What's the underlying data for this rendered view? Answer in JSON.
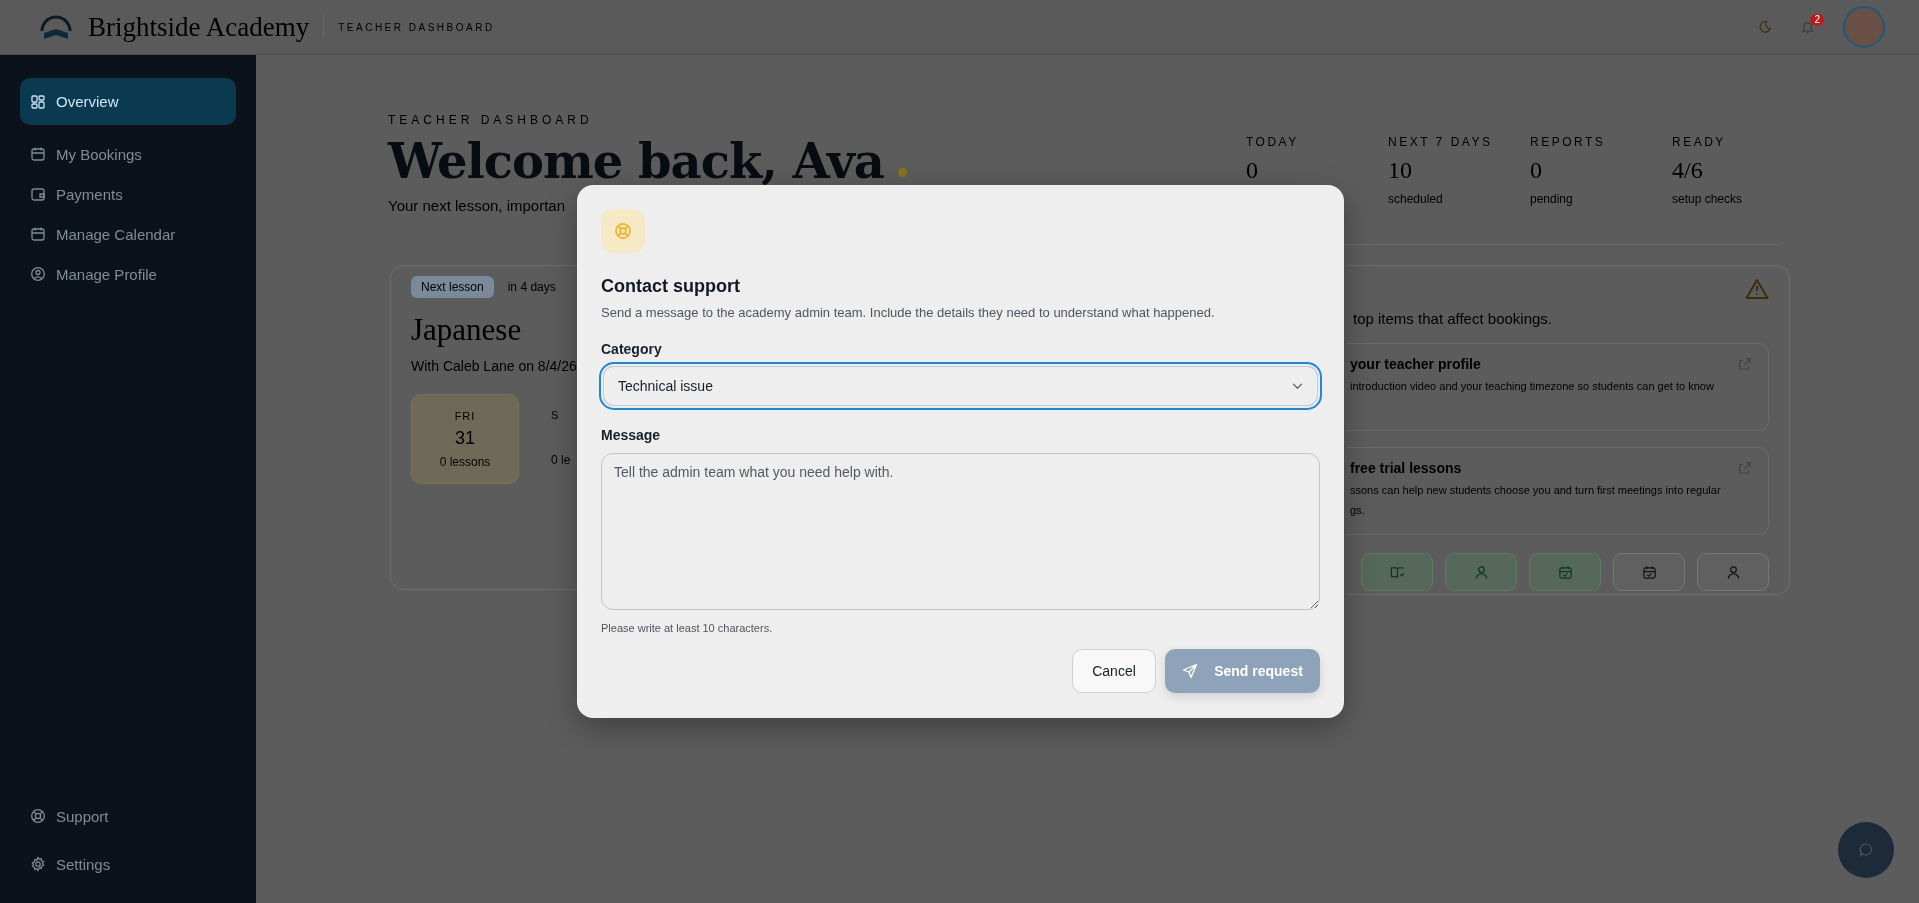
{
  "top_bar": {
    "brand": "Brightside Academy",
    "section": "TEACHER DASHBOARD",
    "notification_count": "2"
  },
  "sidebar": {
    "items": [
      {
        "label": "Overview",
        "selected": true
      },
      {
        "label": "My Bookings",
        "selected": false
      },
      {
        "label": "Payments",
        "selected": false
      },
      {
        "label": "Manage Calendar",
        "selected": false
      },
      {
        "label": "Manage Profile",
        "selected": false
      }
    ],
    "footer_items": [
      {
        "label": "Support"
      },
      {
        "label": "Settings"
      }
    ]
  },
  "header": {
    "eyebrow": "TEACHER DASHBOARD",
    "title": "Welcome back, Ava",
    "subtitle": "Your next lesson, importan"
  },
  "stats": [
    {
      "label": "TODAY",
      "value": "0"
    },
    {
      "label": "NEXT 7 DAYS",
      "value": "10",
      "caption": "scheduled"
    },
    {
      "label": "REPORTS",
      "value": "0",
      "caption": "pending"
    },
    {
      "label": "READY",
      "value": "4/6",
      "caption": "setup checks"
    }
  ],
  "next_lesson": {
    "badge": "Next lesson",
    "when": "in 4 days",
    "subject": "Japanese",
    "detail": "With Caleb Lane on 8/4/26",
    "days": [
      {
        "weekday": "FRI",
        "date": "31",
        "count": "0 lessons",
        "selected": true
      },
      {
        "weekday": "S",
        "count": "0 le",
        "selected": false
      }
    ]
  },
  "setup": {
    "intro": "top items that affect bookings.",
    "items": [
      {
        "title": "your teacher profile",
        "lines": [
          "introduction video and your teaching timezone so students can get to know"
        ]
      },
      {
        "title": "free trial lessons",
        "lines": [
          "ssons can help new students choose you and turn first meetings into regular",
          "gs."
        ]
      }
    ],
    "actions": [
      {
        "done": true
      },
      {
        "done": true
      },
      {
        "done": true
      },
      {
        "done": false
      },
      {
        "done": false
      }
    ]
  },
  "modal": {
    "title": "Contact support",
    "description": "Send a message to the academy admin team. Include the details they need to understand what happened.",
    "category_label": "Category",
    "category_value": "Technical issue",
    "message_label": "Message",
    "message_placeholder": "Tell the admin team what you need help with.",
    "hint": "Please write at least 10 characters.",
    "cancel": "Cancel",
    "submit": "Send request",
    "submit_disabled": true
  }
}
